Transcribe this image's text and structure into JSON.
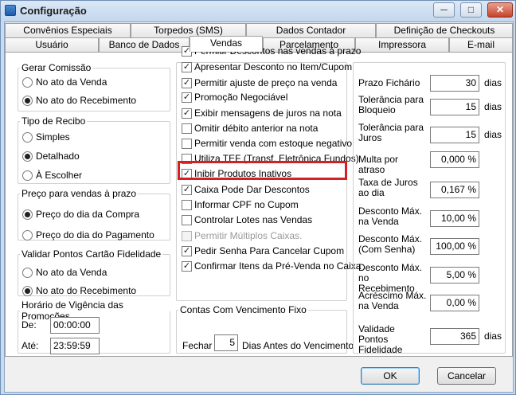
{
  "window": {
    "title": "Configuração",
    "minimize": "─",
    "maximize": "□",
    "close": "✕"
  },
  "tabs_row1": [
    "Convênios Especiais",
    "Torpedos (SMS)",
    "Dados Contador",
    "Definição de Checkouts"
  ],
  "tabs_row2": [
    "Usuário",
    "Banco de Dados",
    "Vendas",
    "Parcelamento",
    "Impressora",
    "E-mail"
  ],
  "active_tab": "Vendas",
  "gerar_comissao": {
    "title": "Gerar Comissão",
    "options": [
      "No ato da Venda",
      "No ato do Recebimento"
    ],
    "selected": 1
  },
  "tipo_recibo": {
    "title": "Tipo de Recibo",
    "options": [
      "Simples",
      "Detalhado",
      "À Escolher"
    ],
    "selected": 1
  },
  "preco_prazo": {
    "title": "Preço para vendas à prazo",
    "options": [
      "Preço do dia da Compra",
      "Preço do dia do Pagamento"
    ],
    "selected": 0
  },
  "validar_pontos": {
    "title": "Validar Pontos Cartão Fidelidade",
    "options": [
      "No ato da Venda",
      "No ato do Recebimento"
    ],
    "selected": 1
  },
  "horario": {
    "title": "Horário de Vigência das Promoções",
    "de_label": "De:",
    "de_value": "00:00:00",
    "ate_label": "Até:",
    "ate_value": "23:59:59"
  },
  "checkboxes": [
    {
      "label": "Permitir Descontos nas vendas à prazo",
      "checked": true,
      "enabled": true
    },
    {
      "label": "Apresentar Desconto no Item/Cupom",
      "checked": true,
      "enabled": true
    },
    {
      "label": "Permitir ajuste de preço na venda",
      "checked": true,
      "enabled": true
    },
    {
      "label": "Promoção Negociável",
      "checked": true,
      "enabled": true
    },
    {
      "label": "Exibir mensagens de juros na nota",
      "checked": true,
      "enabled": true
    },
    {
      "label": "Omitir débito anterior na nota",
      "checked": false,
      "enabled": true
    },
    {
      "label": "Permitir venda com estoque negativo",
      "checked": false,
      "enabled": true
    },
    {
      "label": "Utiliza TEF (Transf. Eletrônica Fundos)",
      "checked": false,
      "enabled": true
    },
    {
      "label": "Inibir Produtos Inativos",
      "checked": true,
      "enabled": true
    },
    {
      "label": "Caixa Pode Dar Descontos",
      "checked": true,
      "enabled": true
    },
    {
      "label": "Informar CPF no Cupom",
      "checked": false,
      "enabled": true
    },
    {
      "label": "Controlar Lotes nas Vendas",
      "checked": false,
      "enabled": true
    },
    {
      "label": "Permitir Múltiplos Caixas.",
      "checked": false,
      "enabled": false
    },
    {
      "label": "Pedir Senha Para Cancelar Cupom",
      "checked": true,
      "enabled": true
    },
    {
      "label": "Confirmar Itens da Pré-Venda no Caixa",
      "checked": true,
      "enabled": true
    }
  ],
  "contas": {
    "title": "Contas Com Vencimento Fixo",
    "fechar_label": "Fechar",
    "dias_value": "5",
    "suffix": "Dias Antes do Vencimento"
  },
  "right_fields": [
    {
      "label": "Prazo Fichário",
      "value": "30",
      "unit": "dias"
    },
    {
      "label": "Tolerância para Bloqueio",
      "value": "15",
      "unit": "dias"
    },
    {
      "label": "Tolerância para Juros",
      "value": "15",
      "unit": "dias"
    },
    {
      "label": "Multa por atraso",
      "value": "0,000 %",
      "unit": ""
    },
    {
      "label": "Taxa de Juros ao dia",
      "value": "0,167 %",
      "unit": ""
    },
    {
      "label": "Desconto Máx. na Venda",
      "value": "10,00 %",
      "unit": ""
    },
    {
      "label": "Desconto Máx. (Com Senha)",
      "value": "100,00 %",
      "unit": ""
    },
    {
      "label": "Desconto Máx. no Recebimento",
      "value": "5,00 %",
      "unit": ""
    },
    {
      "label": "Acréscimo Máx. na Venda",
      "value": "0,00 %",
      "unit": ""
    },
    {
      "label": "Validade Pontos Fidelidade",
      "value": "365",
      "unit": "dias"
    }
  ],
  "buttons": {
    "ok": "OK",
    "cancel": "Cancelar"
  }
}
